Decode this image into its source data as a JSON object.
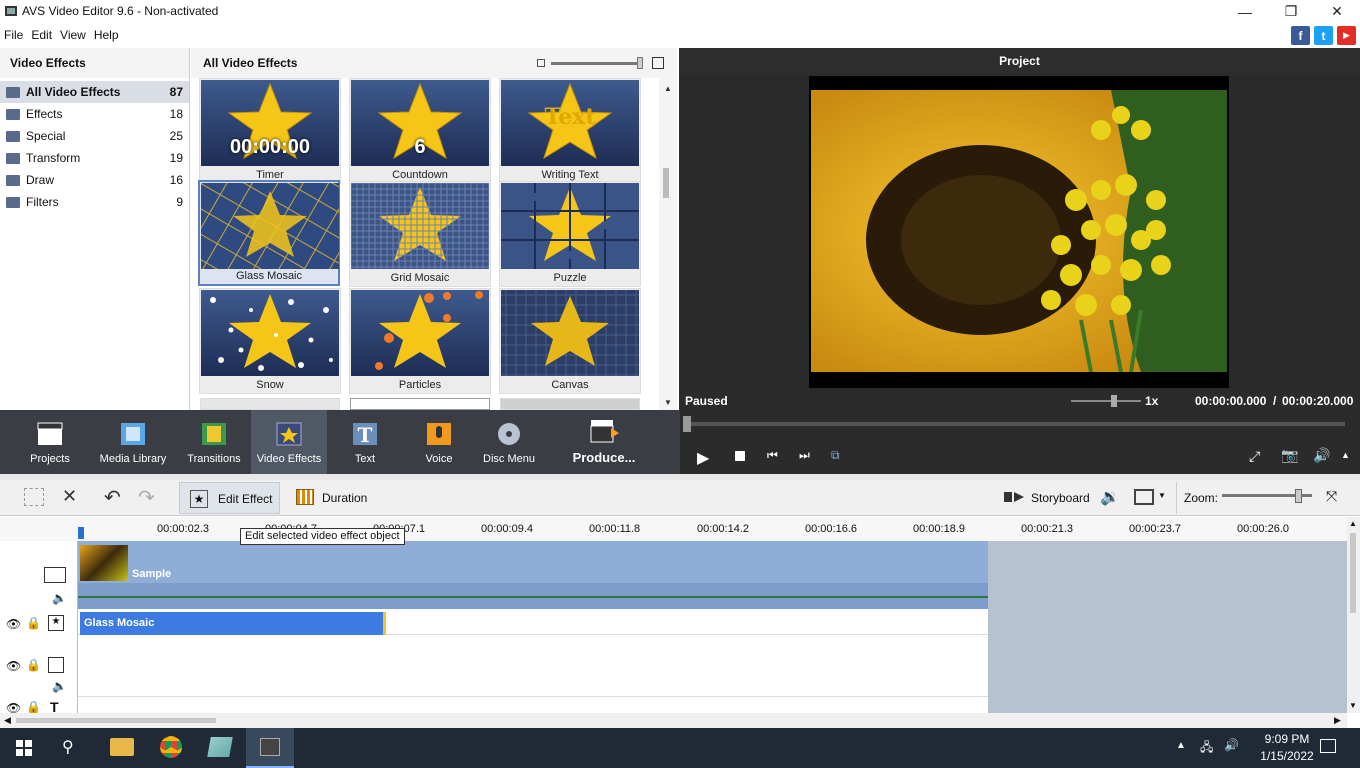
{
  "window": {
    "title": "AVS Video Editor 9.6 - Non-activated"
  },
  "menu": [
    "File",
    "Edit",
    "View",
    "Help"
  ],
  "social": {
    "facebook": "f",
    "twitter": "t",
    "youtube": "▶"
  },
  "categories": {
    "header": "Video Effects",
    "items": [
      {
        "label": "All Video Effects",
        "count": "87"
      },
      {
        "label": "Effects",
        "count": "18"
      },
      {
        "label": "Special",
        "count": "25"
      },
      {
        "label": "Transform",
        "count": "19"
      },
      {
        "label": "Draw",
        "count": "16"
      },
      {
        "label": "Filters",
        "count": "9"
      }
    ]
  },
  "effects": {
    "header": "All Video Effects",
    "tiles": [
      {
        "name": "Timer",
        "overlay": "00:00:00"
      },
      {
        "name": "Countdown",
        "overlay": "6"
      },
      {
        "name": "Writing Text",
        "overlay": "Text"
      },
      {
        "name": "Glass Mosaic",
        "overlay": ""
      },
      {
        "name": "Grid Mosaic",
        "overlay": ""
      },
      {
        "name": "Puzzle",
        "overlay": ""
      },
      {
        "name": "Snow",
        "overlay": ""
      },
      {
        "name": "Particles",
        "overlay": ""
      },
      {
        "name": "Canvas",
        "overlay": ""
      }
    ]
  },
  "preview": {
    "header": "Project",
    "status": "Paused",
    "speed": "1x",
    "time_current": "00:00:00.000",
    "time_sep": "/",
    "time_total": "00:00:20.000"
  },
  "toolbar": {
    "items": [
      "Projects",
      "Media Library",
      "Transitions",
      "Video Effects",
      "Text",
      "Voice",
      "Disc Menu",
      "Produce..."
    ]
  },
  "edit_toolbar": {
    "edit_effect": "Edit Effect",
    "duration": "Duration",
    "storyboard": "Storyboard",
    "zoom": "Zoom:"
  },
  "tooltip": "Edit selected video effect object",
  "ruler": [
    "00:00:02.3",
    "00:00:04.7",
    "00:00:07.1",
    "00:00:09.4",
    "00:00:11.8",
    "00:00:14.2",
    "00:00:16.6",
    "00:00:18.9",
    "00:00:21.3",
    "00:00:23.7",
    "00:00:26.0"
  ],
  "timeline": {
    "video_clip": "Sample",
    "effect_clip": "Glass Mosaic"
  },
  "taskbar": {
    "time": "9:09 PM",
    "date": "1/15/2022"
  }
}
